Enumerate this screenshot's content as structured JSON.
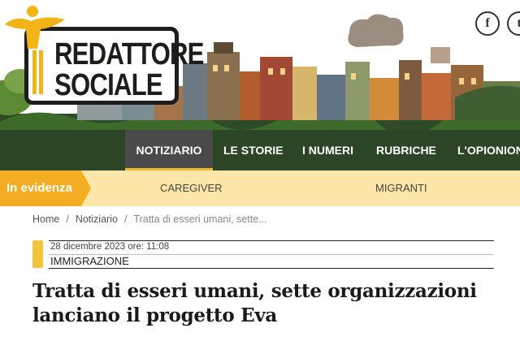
{
  "logo": {
    "line1": "REDATTORE",
    "line2": "SOCIALE"
  },
  "social": {
    "facebook_glyph": "f",
    "twitter_glyph": "t"
  },
  "nav": {
    "items": [
      {
        "label": "NOTIZIARIO",
        "active": true
      },
      {
        "label": "LE STORIE",
        "active": false
      },
      {
        "label": "I NUMERI",
        "active": false
      },
      {
        "label": "RUBRICHE",
        "active": false
      },
      {
        "label": "L'OPIONIONE",
        "active": false
      }
    ]
  },
  "evidenza": {
    "label": "In evidenza",
    "links": [
      "CAREGIVER",
      "MIGRANTI"
    ]
  },
  "breadcrumb": {
    "home": "Home",
    "section": "Notiziario",
    "current": "Tratta di esseri umani, sette...",
    "separator": "/"
  },
  "article": {
    "date": "28 dicembre 2023 ore: 11:08",
    "category": "IMMIGRAZIONE",
    "title_line1": "Tratta di esseri umani, sette organizzazioni",
    "title_line2": "lanciano il progetto Eva"
  },
  "colors": {
    "nav_bg": "#2b4526",
    "nav_active": "#4a4a4a",
    "accent_yellow": "#f3ad22",
    "evidenza_bg": "#fde7a8"
  }
}
